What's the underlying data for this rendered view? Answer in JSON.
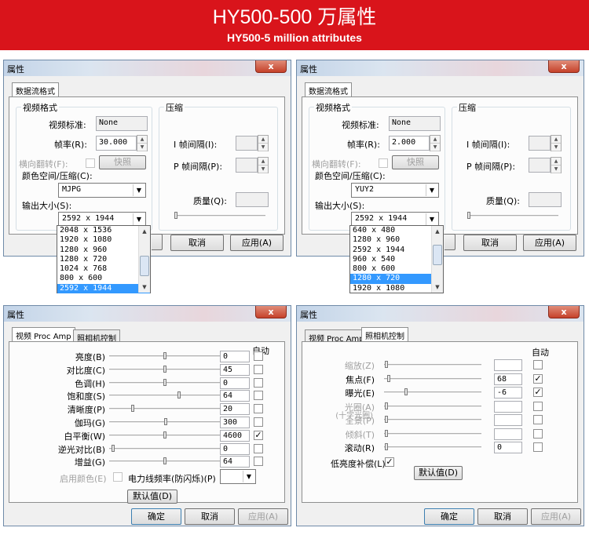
{
  "banner": {
    "title": "HY500-500 万属性",
    "subtitle": "HY500-5 million attributes"
  },
  "window": {
    "title": "属性",
    "close": "x"
  },
  "tabs": {
    "stream": "数据流格式",
    "video_proc_amp": "视频 Proc Amp",
    "camera_control": "照相机控制"
  },
  "stream": {
    "video_format_group": "视频格式",
    "compression_group": "压缩",
    "video_standard_label": "视频标准:",
    "frame_rate_label": "帧率(R):",
    "flip_label": "横向翻转(F):",
    "snapshot_button": "快照",
    "color_space_label": "颜色空间/压缩(C):",
    "output_size_label": "输出大小(S):",
    "i_interval_label": "I 帧间隔(I):",
    "p_interval_label": "P 帧间隔(P):",
    "quality_label": "质量(Q):",
    "cancel": "取消",
    "apply": "应用(A)",
    "left": {
      "video_standard": "None",
      "frame_rate": "30.000",
      "color_space": "MJPG",
      "output_size": "2592 x 1944",
      "options": [
        "2048 x 1536",
        "1920 x 1080",
        "1280 x 960",
        "1280 x 720",
        "1024 x 768",
        "800 x 600",
        "2592 x 1944"
      ]
    },
    "right": {
      "video_standard": "None",
      "frame_rate": "2.000",
      "color_space": "YUY2",
      "output_size": "2592 x 1944",
      "options": [
        "640 x 480",
        "1280 x 960",
        "2592 x 1944",
        "960 x 540",
        "800 x 600",
        "1280 x 720",
        "1920 x 1080"
      ]
    }
  },
  "proc": {
    "auto_label": "自动",
    "rows": [
      {
        "label": "亮度(B)",
        "value": "0",
        "level": 0.49,
        "checked": false
      },
      {
        "label": "对比度(C)",
        "value": "45",
        "level": 0.49,
        "checked": false
      },
      {
        "label": "色调(H)",
        "value": "0",
        "level": 0.49,
        "checked": false
      },
      {
        "label": "饱和度(S)",
        "value": "64",
        "level": 0.62,
        "checked": false
      },
      {
        "label": "清晰度(P)",
        "value": "20",
        "level": 0.2,
        "checked": false
      },
      {
        "label": "伽玛(G)",
        "value": "300",
        "level": 0.5,
        "checked": false
      },
      {
        "label": "白平衡(W)",
        "value": "4600",
        "level": 0.49,
        "checked": true
      },
      {
        "label": "逆光对比(B)",
        "value": "0",
        "level": 0.02,
        "checked": false
      },
      {
        "label": "增益(G)",
        "value": "64",
        "level": 0.49,
        "checked": false
      }
    ],
    "color_enable_label": "启用颜色(E)",
    "powerline_label": "电力线频率(防闪烁)(P)",
    "default_button": "默认值(D)",
    "ok": "确定",
    "cancel": "取消",
    "apply": "应用(A)"
  },
  "camera": {
    "auto_label": "自动",
    "rows": [
      {
        "label": "缩放(Z)",
        "value": "",
        "level": 0.01,
        "enabled": false,
        "checked": false
      },
      {
        "label": "焦点(F)",
        "value": "68",
        "level": 0.03,
        "enabled": true,
        "checked": true
      },
      {
        "label": "曝光(E)",
        "value": "-6",
        "level": 0.22,
        "enabled": true,
        "checked": true
      },
      {
        "label": "光圈(A)",
        "sublabel": "(十字光圈)",
        "value": "",
        "level": 0.01,
        "enabled": false,
        "checked": false
      },
      {
        "label": "全景(P)",
        "value": "",
        "level": 0.01,
        "enabled": false,
        "checked": false
      },
      {
        "label": "倾斜(T)",
        "value": "",
        "level": 0.01,
        "enabled": false,
        "checked": false
      },
      {
        "label": "滚动(R)",
        "value": "0",
        "level": 0.01,
        "enabled": true,
        "checked": false
      }
    ],
    "low_light_label": "低亮度补偿(L)",
    "low_light_checked": true,
    "default_button": "默认值(D)",
    "ok": "确定",
    "cancel": "取消",
    "apply": "应用(A)"
  }
}
